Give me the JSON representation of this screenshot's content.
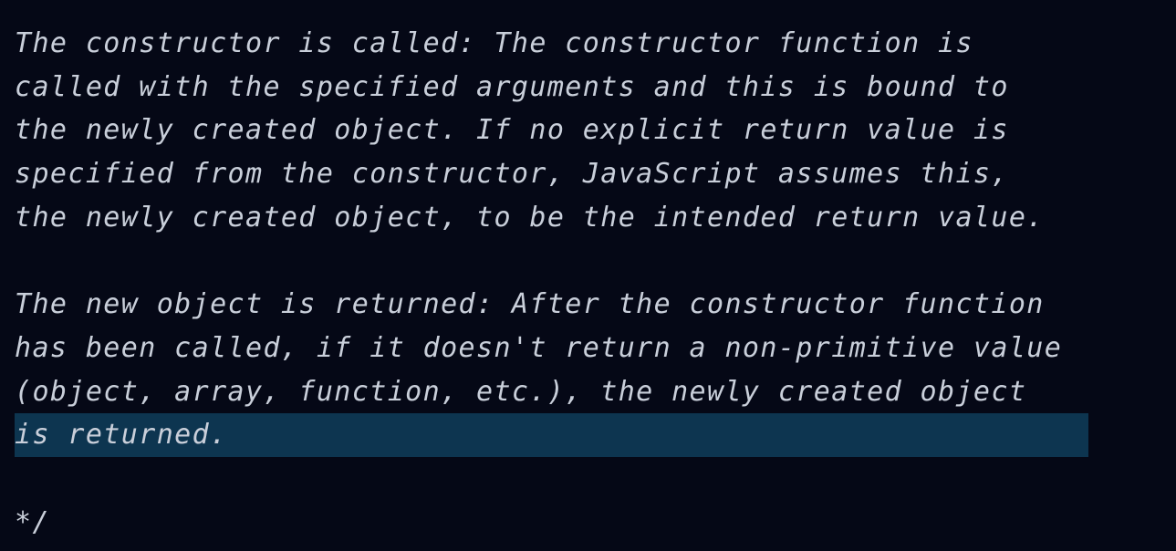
{
  "editor": {
    "colors": {
      "background": "#050816",
      "text": "#c9cfda",
      "selection": "#0d3550"
    },
    "lines": [
      "The constructor is called: The constructor function is",
      "called with the specified arguments and this is bound to",
      "the newly created object. If no explicit return value is",
      "specified from the constructor, JavaScript assumes this,",
      "the newly created object, to be the intended return value.",
      "",
      "The new object is returned: After the constructor function",
      "has been called, if it doesn't return a non-primitive value",
      "(object, array, function, etc.), the newly created object",
      "is returned.",
      "",
      "*/"
    ],
    "selected_line": "is returned."
  }
}
